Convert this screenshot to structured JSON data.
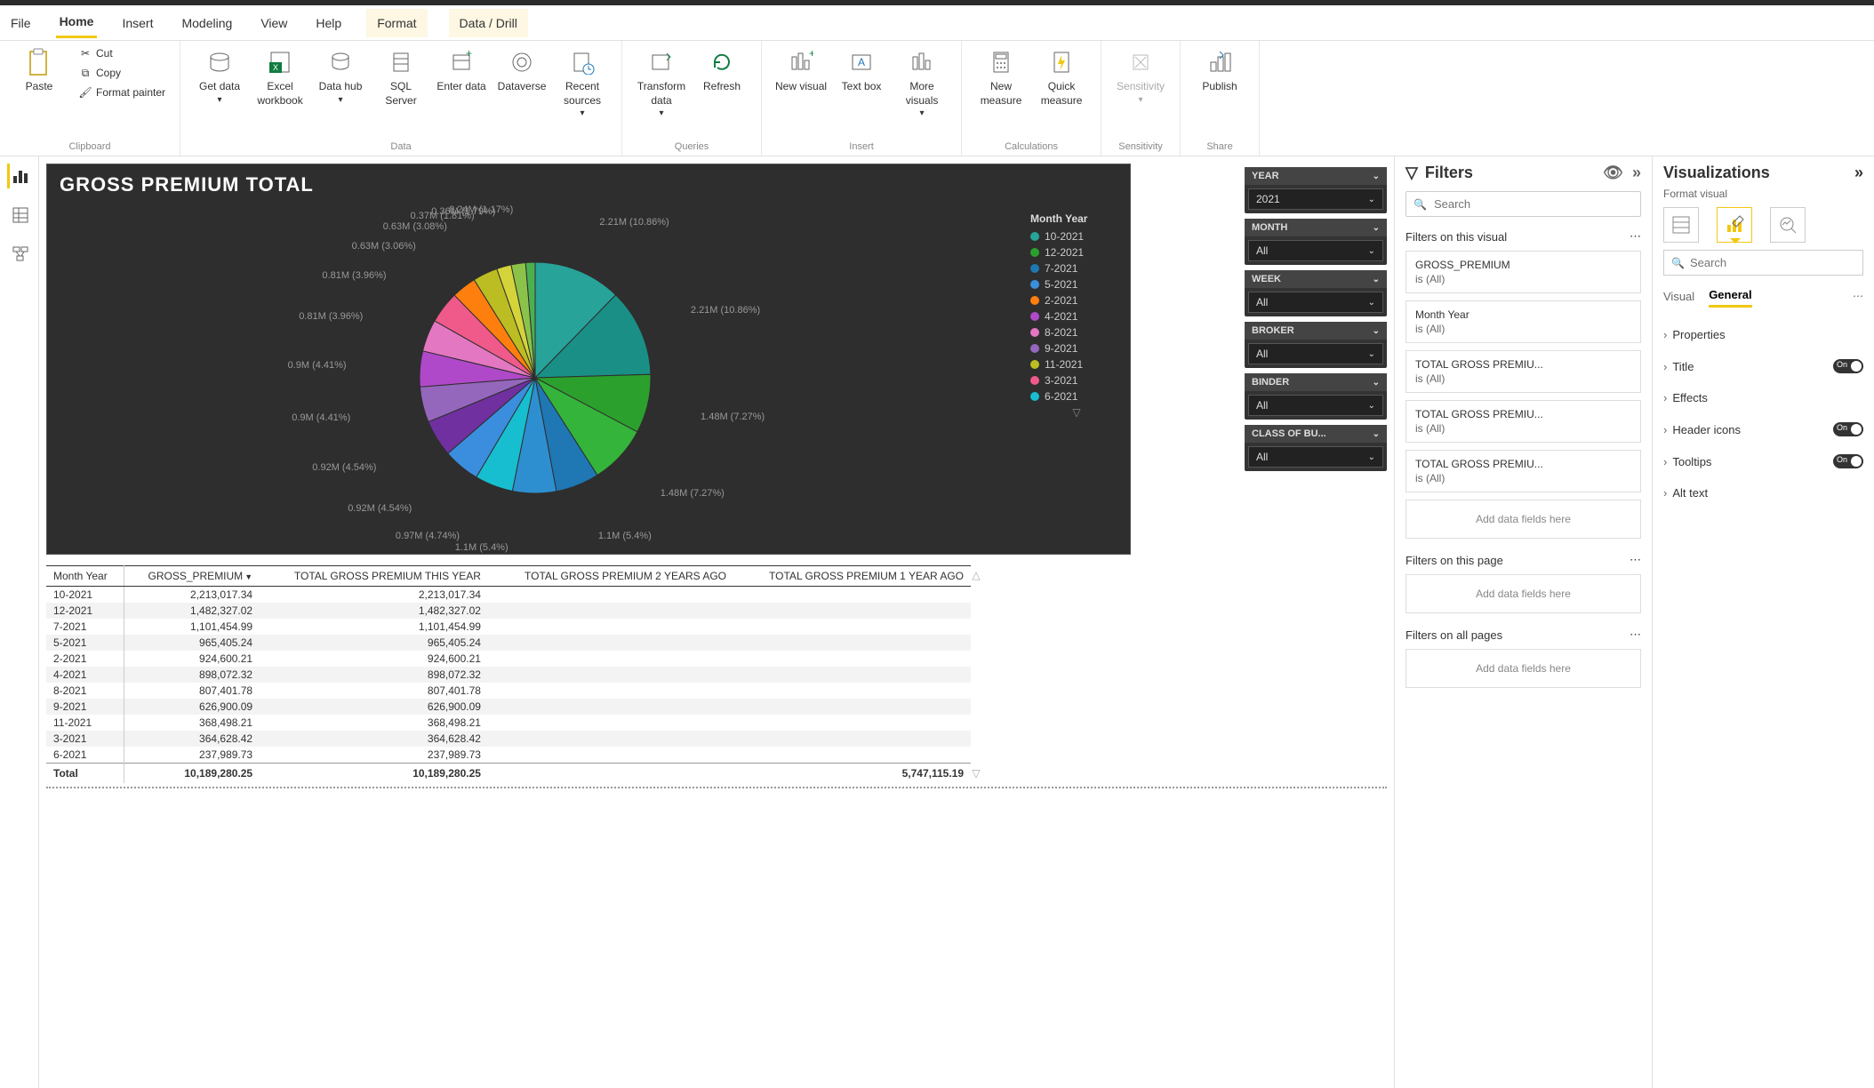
{
  "menu": {
    "tabs": [
      "File",
      "Home",
      "Insert",
      "Modeling",
      "View",
      "Help",
      "Format",
      "Data / Drill"
    ],
    "active": "Home",
    "highlighted": [
      "Format",
      "Data / Drill"
    ]
  },
  "ribbon": {
    "clipboard": {
      "paste": "Paste",
      "cut": "Cut",
      "copy": "Copy",
      "format_painter": "Format painter",
      "group": "Clipboard"
    },
    "data": {
      "get_data": "Get data",
      "excel": "Excel workbook",
      "data_hub": "Data hub",
      "sql": "SQL Server",
      "enter_data": "Enter data",
      "dataverse": "Dataverse",
      "recent": "Recent sources",
      "group": "Data"
    },
    "queries": {
      "transform": "Transform data",
      "refresh": "Refresh",
      "group": "Queries"
    },
    "insert": {
      "new_visual": "New visual",
      "text_box": "Text box",
      "more": "More visuals",
      "group": "Insert"
    },
    "calc": {
      "new_measure": "New measure",
      "quick": "Quick measure",
      "group": "Calculations"
    },
    "sensitivity": {
      "sensitivity": "Sensitivity",
      "group": "Sensitivity"
    },
    "share": {
      "publish": "Publish",
      "group": "Share"
    }
  },
  "chart_data": {
    "type": "pie",
    "title": "GROSS PREMIUM TOTAL",
    "legend_title": "Month Year",
    "legend": [
      {
        "label": "10-2021",
        "color": "#27a39a"
      },
      {
        "label": "12-2021",
        "color": "#2ca02c"
      },
      {
        "label": "7-2021",
        "color": "#1f77b4"
      },
      {
        "label": "5-2021",
        "color": "#3b8ede"
      },
      {
        "label": "2-2021",
        "color": "#ff7f0e"
      },
      {
        "label": "4-2021",
        "color": "#b049c9"
      },
      {
        "label": "8-2021",
        "color": "#e377c2"
      },
      {
        "label": "9-2021",
        "color": "#9467bd"
      },
      {
        "label": "11-2021",
        "color": "#bcbd22"
      },
      {
        "label": "3-2021",
        "color": "#ef5a8a"
      },
      {
        "label": "6-2021",
        "color": "#17becf"
      }
    ],
    "slice_labels": [
      "2.21M (10.86%)",
      "2.21M (10.86%)",
      "1.48M (7.27%)",
      "1.48M (7.27%)",
      "1.1M (5.4%)",
      "1.1M (5.4%)",
      "0.97M (4.74%)",
      "0.92M (4.54%)",
      "0.92M (4.54%)",
      "0.9M (4.41%)",
      "0.9M (4.41%)",
      "0.81M (3.96%)",
      "0.81M (3.96%)",
      "0.63M (3.06%)",
      "0.63M (3.08%)",
      "0.37M (1.81%)",
      "0.36M (1.79%)",
      "0.24M (1.17%)"
    ],
    "slice_colors": [
      "#27a39a",
      "#1a8f86",
      "#2ca02c",
      "#34b43a",
      "#1f77b4",
      "#2e8fd0",
      "#17becf",
      "#3b8ede",
      "#7030a0",
      "#9467bd",
      "#b049c9",
      "#e377c2",
      "#ef5a8a",
      "#ff7f0e",
      "#bcbd22",
      "#d4d43a",
      "#8bc34a",
      "#4caf50"
    ]
  },
  "slicers": [
    {
      "title": "YEAR",
      "value": "2021"
    },
    {
      "title": "MONTH",
      "value": "All"
    },
    {
      "title": "WEEK",
      "value": "All"
    },
    {
      "title": "BROKER",
      "value": "All"
    },
    {
      "title": "BINDER",
      "value": "All"
    },
    {
      "title": "CLASS OF BU...",
      "value": "All"
    }
  ],
  "table": {
    "columns": [
      "Month Year",
      "GROSS_PREMIUM",
      "TOTAL GROSS PREMIUM THIS YEAR",
      "TOTAL GROSS PREMIUM 2 YEARS AGO",
      "TOTAL GROSS PREMIUM 1 YEAR AGO"
    ],
    "rows": [
      [
        "10-2021",
        "2,213,017.34",
        "2,213,017.34",
        "",
        ""
      ],
      [
        "12-2021",
        "1,482,327.02",
        "1,482,327.02",
        "",
        ""
      ],
      [
        "7-2021",
        "1,101,454.99",
        "1,101,454.99",
        "",
        ""
      ],
      [
        "5-2021",
        "965,405.24",
        "965,405.24",
        "",
        ""
      ],
      [
        "2-2021",
        "924,600.21",
        "924,600.21",
        "",
        ""
      ],
      [
        "4-2021",
        "898,072.32",
        "898,072.32",
        "",
        ""
      ],
      [
        "8-2021",
        "807,401.78",
        "807,401.78",
        "",
        ""
      ],
      [
        "9-2021",
        "626,900.09",
        "626,900.09",
        "",
        ""
      ],
      [
        "11-2021",
        "368,498.21",
        "368,498.21",
        "",
        ""
      ],
      [
        "3-2021",
        "364,628.42",
        "364,628.42",
        "",
        ""
      ],
      [
        "6-2021",
        "237,989.73",
        "237,989.73",
        "",
        ""
      ]
    ],
    "total_label": "Total",
    "totals": [
      "10,189,280.25",
      "10,189,280.25",
      "",
      "5,747,115.19"
    ]
  },
  "filters": {
    "title": "Filters",
    "search_ph": "Search",
    "on_visual": "Filters on this visual",
    "on_page": "Filters on this page",
    "on_all": "Filters on all pages",
    "add_fields": "Add data fields here",
    "cards": [
      {
        "name": "GROSS_PREMIUM",
        "val": "is (All)"
      },
      {
        "name": "Month Year",
        "val": "is (All)"
      },
      {
        "name": "TOTAL GROSS PREMIU...",
        "val": "is (All)"
      },
      {
        "name": "TOTAL GROSS PREMIU...",
        "val": "is (All)"
      },
      {
        "name": "TOTAL GROSS PREMIU...",
        "val": "is (All)"
      }
    ]
  },
  "viz": {
    "title": "Visualizations",
    "subtitle": "Format visual",
    "search_ph": "Search",
    "tabs": {
      "visual": "Visual",
      "general": "General"
    },
    "props": [
      {
        "label": "Properties",
        "toggle": null
      },
      {
        "label": "Title",
        "toggle": "On"
      },
      {
        "label": "Effects",
        "toggle": null
      },
      {
        "label": "Header icons",
        "toggle": "On"
      },
      {
        "label": "Tooltips",
        "toggle": "On"
      },
      {
        "label": "Alt text",
        "toggle": null
      }
    ]
  }
}
